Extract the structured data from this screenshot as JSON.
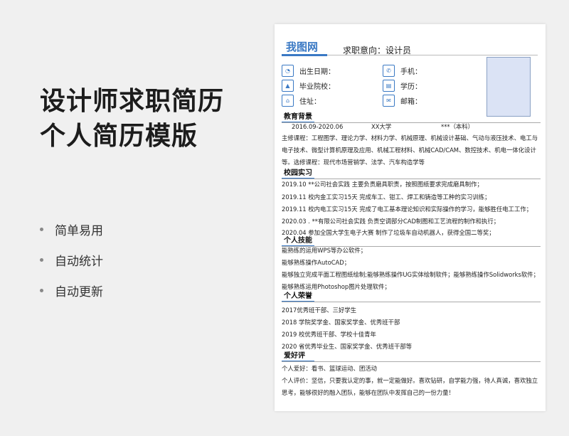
{
  "hero": {
    "title_line1": "设计师求职简历",
    "title_line2": "个人简历模版"
  },
  "features": [
    "简单易用",
    "自动统计",
    "自动更新"
  ],
  "resume": {
    "brand": "我图网",
    "job_intention": "求职意向：设计员",
    "info": {
      "birth": "出生日期：",
      "school": "毕业院校：",
      "address": "住址：",
      "phone": "手机：",
      "degree": "学历：",
      "email": "邮箱："
    },
    "education": {
      "title": "教育背景",
      "period": "2016.09-2020.06",
      "university": "XX大学",
      "level": "***（本科）",
      "courses": "主修课程：工程图学、理论力学、材料力学、机械原理、机械设计基础、气动与液压技术、电工与电子技术、微型计算机原理及应用、机械工程材料、机械CAD/CAM、数控技术、机电一体化设计等。选修课程：现代市场营销学、法学、汽车构造学等"
    },
    "internship": {
      "title": "校园实习",
      "items": [
        "2019.10 **公司社会实践    主要负责磨具职责，按照图纸要求完成磨具制作；",
        "2019.11 校内金工实习15天    完成车工、钳工、焊工和铸造等工种的实习训练；",
        "2019.11 校内电工实习15天    完成了电工基本理论知识和实际操作的学习，能够胜任电工工作；",
        "2020.03 . **有限公司社会实践    负责空调部分CAD制图和工艺流程的制作和执行；",
        "2020.04 参加全国大学生电子大赛    制作了垃圾车自动机器人，获得全国二等奖；"
      ]
    },
    "skills": {
      "title": "个人技能",
      "items": [
        "能熟练的运用WPS等办公软件；",
        "能够熟练操作AutoCAD；",
        "能够独立完成平面工程图纸绘制;能够熟练操作UG实体绘制软件；能够熟练操作Solidworks软件；",
        "能够熟练运用Photoshop图片处理软件；"
      ]
    },
    "honors": {
      "title": "个人荣誉",
      "items": [
        "2017优秀班干部、三好学生",
        "2018 学院奖学金、国家奖学金、优秀班干部",
        "2019 校优秀班干部、学校十佳青年",
        "2020 省优秀毕业生、国家奖学金、优秀班干部等"
      ]
    },
    "hobby": {
      "title": "爱好评",
      "hobbies": "个人爱好：看书、篮球运动、团活动",
      "evaluation": "个人评价：坚信，只要我认定的事，就一定能做好。喜欢钻研，自学能力强，待人真诚，喜欢独立思考，能够很好的融入团队，能够在团队中发挥自己的一份力量！"
    }
  }
}
